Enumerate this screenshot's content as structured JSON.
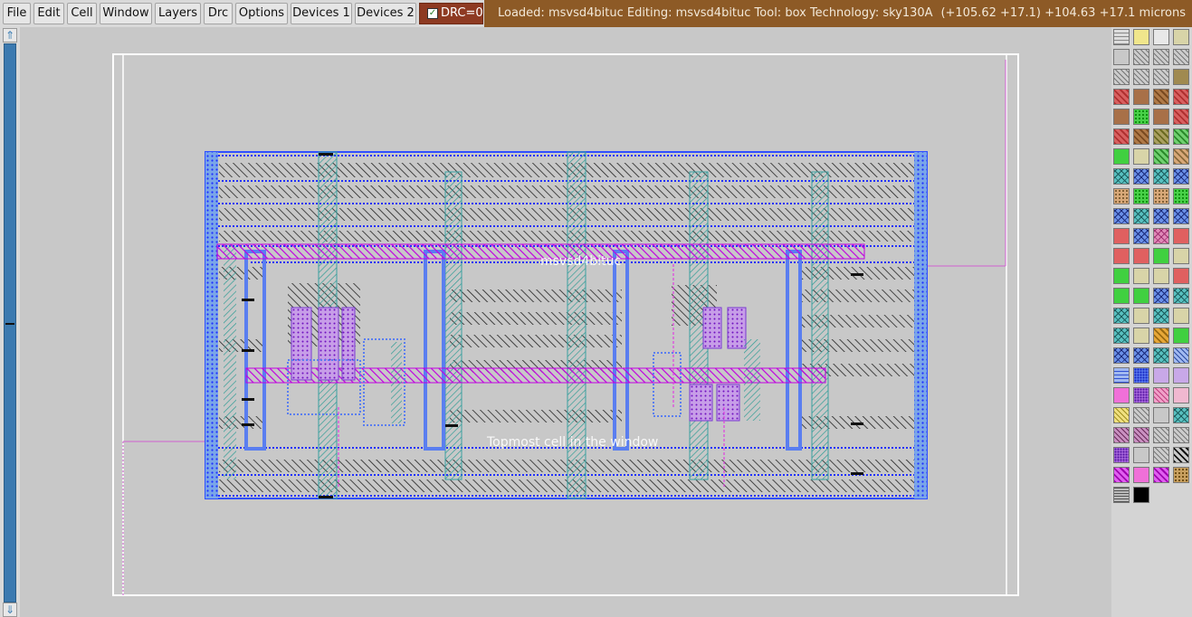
{
  "menu": {
    "file": "File",
    "edit": "Edit",
    "cell": "Cell",
    "window": "Window",
    "layers": "Layers",
    "drc": "Drc",
    "options": "Options",
    "devices1": "Devices 1",
    "devices2": "Devices 2"
  },
  "drc_indicator": {
    "label": "DRC=0",
    "checked": true
  },
  "status": {
    "text": "Loaded: msvsd4bituc Editing: msvsd4bituc Tool: box  Technology: sky130A",
    "coords": "(+105.62 +17.1) +104.63 +17.1 microns"
  },
  "canvas": {
    "cell_name_label": "msvsd4bituc",
    "topmost_label": "Topmost cell in the window"
  },
  "colors": {
    "menubar": "#d9d9d9",
    "drc_box": "#8e3a22",
    "status_bar": "#8d5a26",
    "canvas_bg": "#c8c8c8",
    "scrollbar": "#3c7ab0",
    "metal_purple": "#c000e0",
    "local_blue": "#3050ff",
    "poly_teal": "#3aa0a0"
  },
  "palette": {
    "swatches": [
      "grid",
      "yellow",
      "black-outline",
      "tan",
      "gray",
      "gray-hatch",
      "gray-hatch",
      "gray-hatch",
      "gray-hatch",
      "gray-hatch",
      "gray-hatch",
      "olive",
      "red-hatch",
      "brown",
      "brown-hatch",
      "red-hatch",
      "brown",
      "green-dots",
      "brown",
      "red-hatch",
      "red-hatch",
      "brown-hatch",
      "olive-hatch",
      "green-hatch",
      "green",
      "tan",
      "green-hatch",
      "tan-hatch",
      "teal-x",
      "blue-x",
      "teal-x",
      "blue-x",
      "tan-dots",
      "green-dots",
      "tan-dots",
      "green-dots",
      "blue-x",
      "teal-x",
      "blue-x",
      "blue-x",
      "red",
      "blue-x",
      "pink-x",
      "red",
      "red",
      "red",
      "green",
      "tan",
      "green",
      "tan",
      "tan",
      "red",
      "green",
      "green",
      "blue-x",
      "teal-x",
      "teal-x",
      "tan",
      "teal-x",
      "tan",
      "teal-x",
      "tan",
      "orange-hatch",
      "green",
      "blue-x",
      "blue-x",
      "teal-x",
      "blue-hatch",
      "blue-wave",
      "blue-dots",
      "lilac",
      "lilac",
      "magenta",
      "purple-dots",
      "pink-hatch",
      "pink",
      "yellow-hatch",
      "gray-hatch",
      "gray",
      "teal-x",
      "plum-hatch",
      "plum-hatch",
      "gray-hatch",
      "gray-hatch",
      "purple-dots",
      "gray",
      "gray-hatch",
      "black-hatch",
      "magenta-hatch",
      "magenta",
      "magenta-hatch",
      "gold-dots",
      "gray-wave",
      "black"
    ]
  }
}
